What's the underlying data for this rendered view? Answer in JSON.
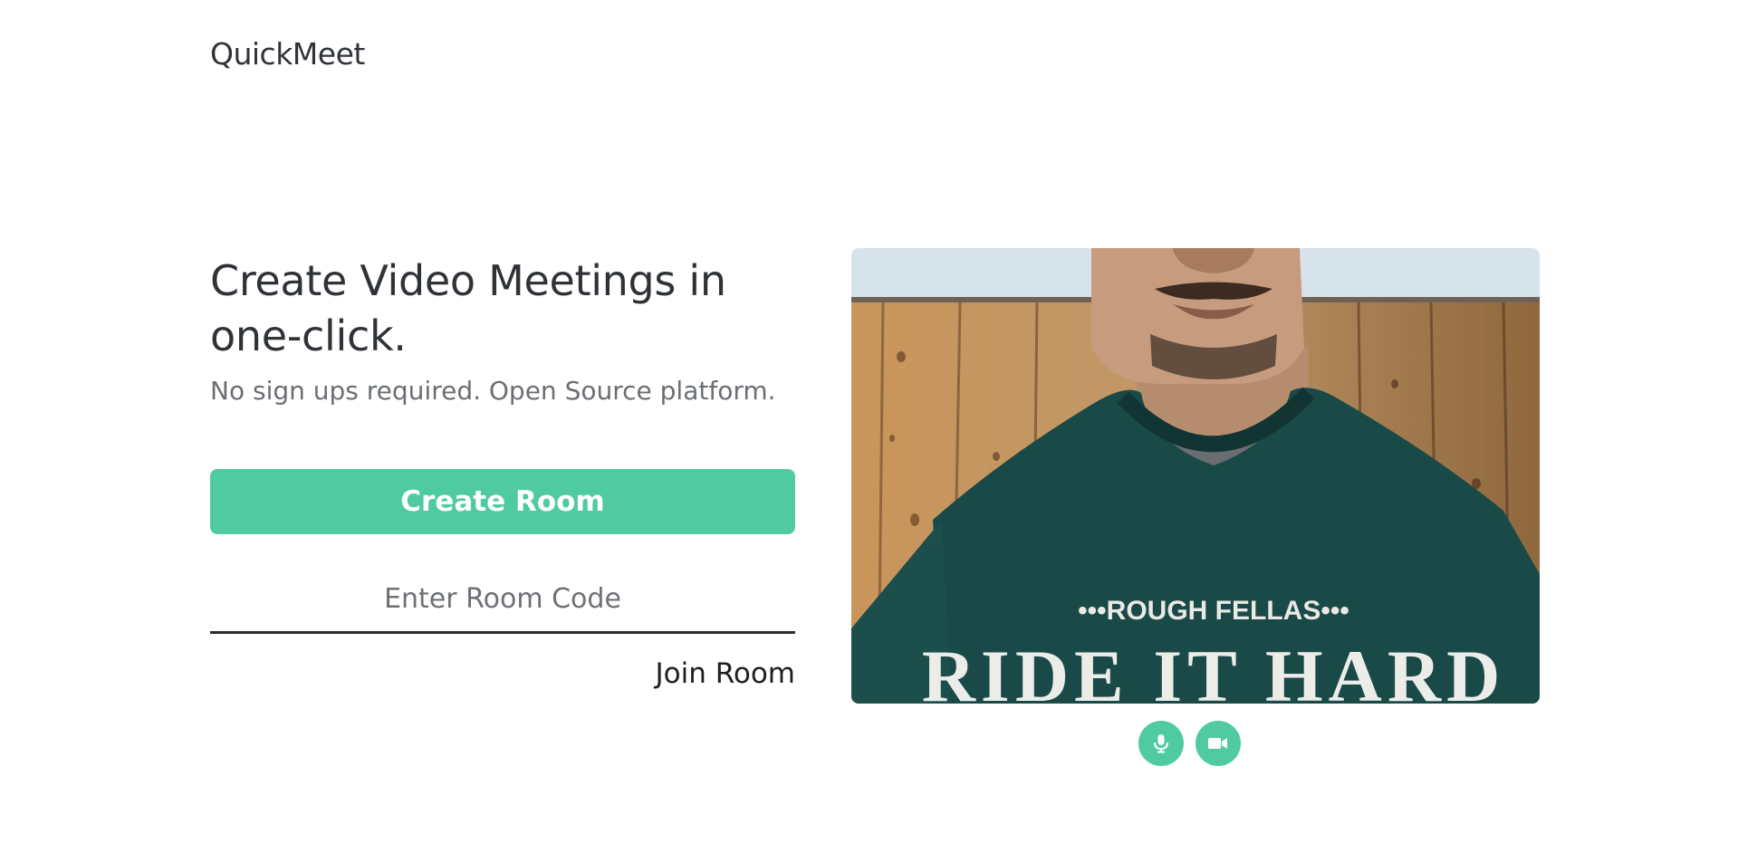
{
  "header": {
    "brand": "QuickMeet"
  },
  "hero": {
    "headline": "Create Video Meetings in one-click.",
    "subline": "No sign ups required. Open Source platform."
  },
  "actions": {
    "create_label": "Create Room",
    "room_code_placeholder": "Enter Room Code",
    "room_code_value": "",
    "join_label": "Join Room"
  },
  "preview": {
    "shirt_text_top": "•••ROUGH FELLAS•••",
    "shirt_text_bottom": "RIDE IT HARD",
    "controls": [
      {
        "name": "mic-toggle",
        "icon": "microphone-icon"
      },
      {
        "name": "camera-toggle",
        "icon": "video-camera-icon"
      }
    ]
  },
  "colors": {
    "accent": "#50cba1",
    "text_dark": "#2f3338",
    "text_muted": "#6b6f73"
  }
}
